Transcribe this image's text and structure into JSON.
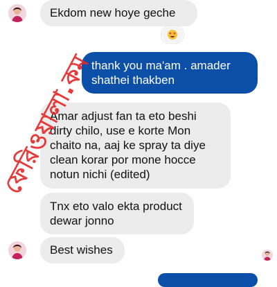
{
  "messages": [
    {
      "text": "Ekdom new hoye geche"
    },
    {
      "text": "thank you ma'am . amader shathei thakben"
    },
    {
      "text": "Amar adjust fan ta eto beshi dirty chilo, use e korte Mon chaito na, aaj ke spray ta diye clean korar por mone hocce notun nichi (edited)"
    },
    {
      "text": "Tnx eto valo ekta product dewar jonno"
    },
    {
      "text": "Best wishes"
    }
  ],
  "reaction": {
    "icon": "heart-eyes-emoji-icon"
  },
  "watermark": {
    "text": "ফেরিওয়ালা.কম"
  },
  "colors": {
    "incoming_bubble": "#ececec",
    "outgoing_bubble": "#0b4fa8",
    "watermark": "#e52b2b"
  }
}
